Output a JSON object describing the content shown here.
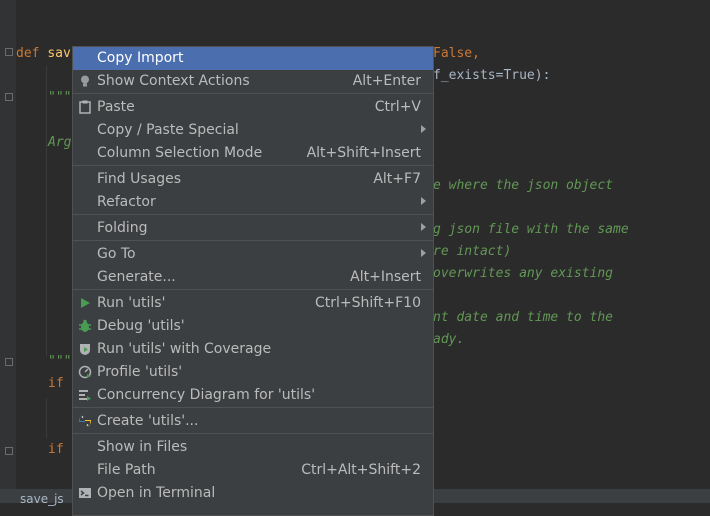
{
  "editor": {
    "lines": [
      {
        "def": "def",
        "name": "sav"
      },
      {
        "frag": "False,"
      },
      {
        "frag": "f_exists=True):"
      },
      {
        "quote1": "\"\"\""
      },
      {
        "args": "Arg"
      },
      {
        "doc1": "e where the json object"
      },
      {
        "doc2": "g json file with the same"
      },
      {
        "doc3": "re intact)"
      },
      {
        "doc4": "overwrites any existing"
      },
      {
        "doc5": "nt date and time to the"
      },
      {
        "doc6": "ady."
      },
      {
        "quote2": "\"\"\""
      },
      {
        "if1": "if"
      },
      {
        "if2": "if"
      }
    ],
    "bottom_tab": "save_js"
  },
  "menu": {
    "items": [
      {
        "label": "Copy Import",
        "shortcut": "",
        "submenu": false,
        "icon": "",
        "selected": true
      },
      {
        "label": "Show Context Actions",
        "shortcut": "Alt+Enter",
        "submenu": false,
        "icon": "lightbulb-icon"
      },
      {
        "label": "Paste",
        "shortcut": "Ctrl+V",
        "submenu": false,
        "icon": "clipboard-icon"
      },
      {
        "label": "Copy / Paste Special",
        "shortcut": "",
        "submenu": true,
        "icon": ""
      },
      {
        "label": "Column Selection Mode",
        "shortcut": "Alt+Shift+Insert",
        "submenu": false,
        "icon": ""
      },
      {
        "label": "Find Usages",
        "shortcut": "Alt+F7",
        "submenu": false,
        "icon": ""
      },
      {
        "label": "Refactor",
        "shortcut": "",
        "submenu": true,
        "icon": ""
      },
      {
        "label": "Folding",
        "shortcut": "",
        "submenu": true,
        "icon": ""
      },
      {
        "label": "Go To",
        "shortcut": "",
        "submenu": true,
        "icon": ""
      },
      {
        "label": "Generate...",
        "shortcut": "Alt+Insert",
        "submenu": false,
        "icon": ""
      },
      {
        "label": "Run 'utils'",
        "shortcut": "Ctrl+Shift+F10",
        "submenu": false,
        "icon": "run-icon"
      },
      {
        "label": "Debug 'utils'",
        "shortcut": "",
        "submenu": false,
        "icon": "debug-icon"
      },
      {
        "label": "Run 'utils' with Coverage",
        "shortcut": "",
        "submenu": false,
        "icon": "coverage-icon"
      },
      {
        "label": "Profile 'utils'",
        "shortcut": "",
        "submenu": false,
        "icon": "profile-icon"
      },
      {
        "label": "Concurrency Diagram for 'utils'",
        "shortcut": "",
        "submenu": false,
        "icon": "concurrency-icon"
      },
      {
        "label": "Create 'utils'...",
        "shortcut": "",
        "submenu": false,
        "icon": "python-icon"
      },
      {
        "label": "Show in Files",
        "shortcut": "",
        "submenu": false,
        "icon": ""
      },
      {
        "label": "File Path",
        "shortcut": "Ctrl+Alt+Shift+2",
        "submenu": false,
        "icon": ""
      },
      {
        "label": "Open in Terminal",
        "shortcut": "",
        "submenu": false,
        "icon": "terminal-icon"
      }
    ]
  },
  "colors": {
    "editor_bg": "#2b2b2b",
    "menu_bg": "#3c3f41",
    "selection": "#4b6eaf",
    "keyword": "#cc7832",
    "function": "#ffc66d",
    "docstring": "#629755"
  }
}
